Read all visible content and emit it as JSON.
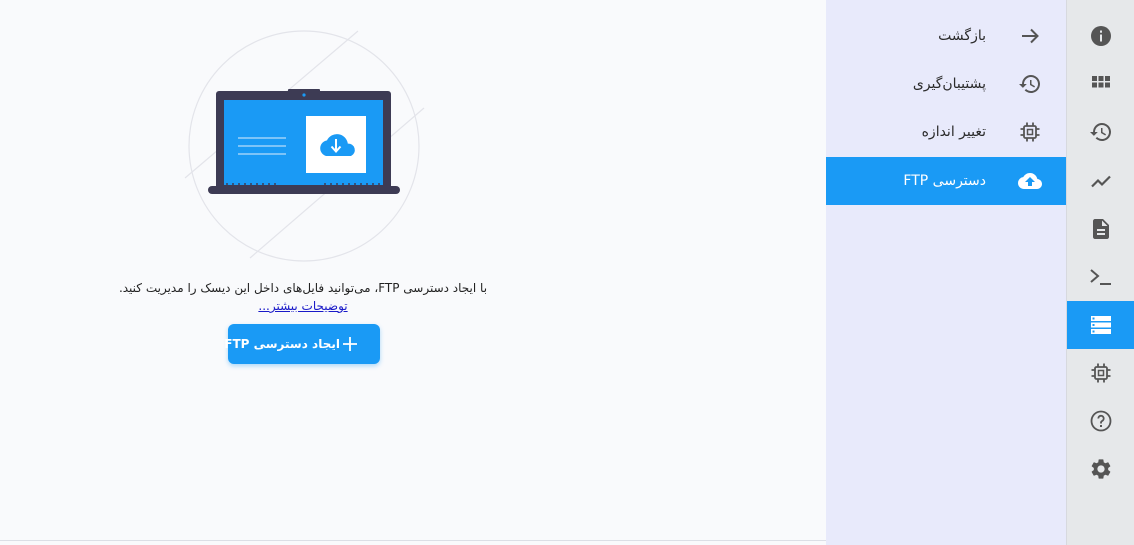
{
  "main": {
    "description": "با ایجاد دسترسی FTP، می‌توانید فایل‌های داخل این دیسک را مدیریت کنید.",
    "more_link": "توضیحات بیشتر...",
    "create_button": "ایجاد دسترسی FTP"
  },
  "menu": {
    "items": [
      {
        "label": "بازگشت",
        "icon": "arrow-right-icon"
      },
      {
        "label": "پشتیبان‌گیری",
        "icon": "history-icon"
      },
      {
        "label": "تغییر اندازه",
        "icon": "chip-icon"
      },
      {
        "label": "دسترسی FTP",
        "icon": "cloud-upload-icon",
        "active": true
      }
    ]
  },
  "rail": {
    "icons": [
      "info-icon",
      "apps-grid-icon",
      "history-icon",
      "chart-line-icon",
      "document-icon",
      "terminal-icon",
      "storage-icon",
      "chip-icon",
      "help-icon",
      "settings-icon"
    ],
    "active_icon": "storage-icon"
  },
  "colors": {
    "accent": "#1a9af5",
    "menu_bg": "#e8eafb",
    "rail_bg": "#e6e8ea",
    "laptop": "#3d3b54"
  }
}
